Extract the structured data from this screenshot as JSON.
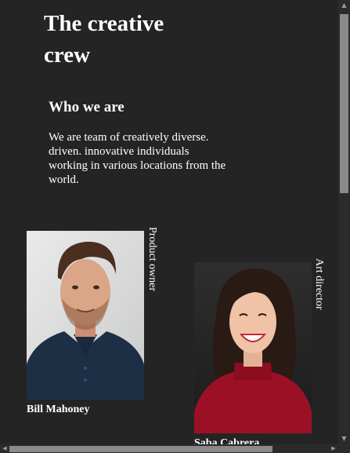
{
  "header": {
    "title": "The creative crew"
  },
  "about": {
    "heading": "Who we are",
    "body": "We are team of creatively diverse. driven. innovative individuals working in various locations from the world."
  },
  "team": [
    {
      "name": "Bill Mahoney",
      "role": "Product owner"
    },
    {
      "name": "Saba Cabrera",
      "role": "Art director"
    }
  ],
  "colors": {
    "background": "#242424",
    "text": "#ffffff",
    "scrollbar_thumb": "#8a8a8a"
  },
  "scrollbars": {
    "vertical_position": 0.0,
    "horizontal_position": 0.0
  }
}
